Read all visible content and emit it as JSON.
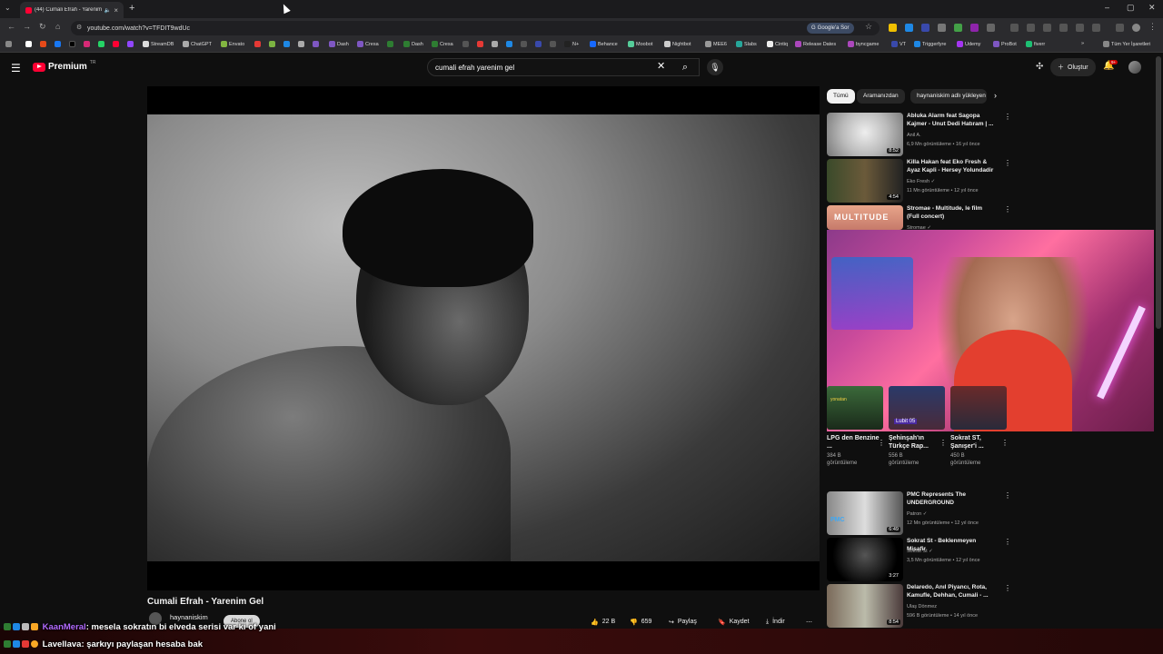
{
  "browser": {
    "tab_title": "(44) Cumali Efrah - Yarenim",
    "url": "youtube.com/watch?v=TFDIT9wdUc",
    "google_save_label": "Google'a Sor",
    "bookmarks": [
      "StreamDB",
      "ChatGPT",
      "Envato",
      "Dash",
      "Cresa",
      "Dash",
      "Cresa",
      "N+",
      "Behance",
      "Moobot",
      "Nightbot",
      "MEE6",
      "Slabs",
      "Cintiq",
      "Release Dates",
      "byncgame",
      "VT",
      "Triggerfyre",
      "Udemy",
      "ProBot",
      "fiverr",
      "Tüm Yer İşaretleri"
    ]
  },
  "youtube": {
    "brand": "Premium",
    "region": "TR",
    "search_query": "cumali efrah yarenim gel",
    "create_label": "Oluştur",
    "notif_count": "9+"
  },
  "video": {
    "title": "Cumali Efrah - Yarenim Gel",
    "channel": "haynaniskim",
    "subscribe_label": "Abone ol",
    "likes": "22 B",
    "dislikes": "659",
    "share_label": "Paylaş",
    "save_label": "Kaydet",
    "download_label": "İndir"
  },
  "chips": [
    "Tümü",
    "Aramanızdan",
    "haynaniskim adlı yükleyen"
  ],
  "recommendations": [
    {
      "title": "Abluka Alarm feat Sagopa Kajmer - Unut Dedi Hatıram | ...",
      "channel": "Anil A.",
      "meta": "6,9 Mn görüntüleme • 16 yıl önce",
      "duration": "8:52"
    },
    {
      "title": "Killa Hakan feat Eko Fresh & Ayaz Kapli - Hersey Yolundadir",
      "channel": "Eko Fresh ✓",
      "meta": "11 Mn görüntüleme • 12 yıl önce",
      "duration": "4:54"
    },
    {
      "title": "Stromae - Multitude, le film (Full concert)",
      "channel": "Stromae ✓",
      "meta": "",
      "duration": ""
    },
    {
      "title": "PMC Represents The UNDERGROUND",
      "channel": "Patron ✓",
      "meta": "12 Mn görüntüleme • 12 yıl önce",
      "duration": "6:49"
    },
    {
      "title": "Sokrat St - Beklenmeyen Misafir",
      "channel": "Sokrat St ✓",
      "meta": "3,5 Mn görüntüleme • 12 yıl önce",
      "duration": "3:27"
    },
    {
      "title": "Delaredo, Anıl Piyancı, Rota, Kamufle, Dehhan, Cumali - ...",
      "channel": "Ulaş Dönmez",
      "meta": "596 B görüntüleme • 14 yıl önce",
      "duration": "8:54"
    }
  ],
  "shorts": [
    {
      "title": "LPG den Benzine ...",
      "views": "384 B",
      "views_label": "görüntüleme"
    },
    {
      "title": "Şehinşah'ın Türkçe Rap...",
      "views": "556 B",
      "views_label": "görüntüleme"
    },
    {
      "title": "Sokrat ST, Şanışer'i ...",
      "views": "450 B",
      "views_label": "görüntüleme"
    }
  ],
  "thumb_texts": {
    "multitude": "MULTITUDE",
    "pmc": "PMC"
  },
  "cam_texts": {
    "a": "Lubit 05",
    "b": "yonatan"
  },
  "chat": [
    {
      "user": "KaanMeral",
      "message": ": mesela sokratın bi elveda serisi var ki öf yani"
    },
    {
      "user": "Lavellava",
      "message": ": şarkıyı paylaşan hesaba bak"
    }
  ],
  "colors": {
    "youtube_red": "#ff0033",
    "chat_user1": "#b26bff"
  },
  "icons": [
    "menu-icon",
    "search-icon",
    "mic-icon",
    "create-icon",
    "bell-icon",
    "like-icon",
    "dislike-icon",
    "share-icon",
    "save-icon",
    "download-icon",
    "more-icon"
  ]
}
